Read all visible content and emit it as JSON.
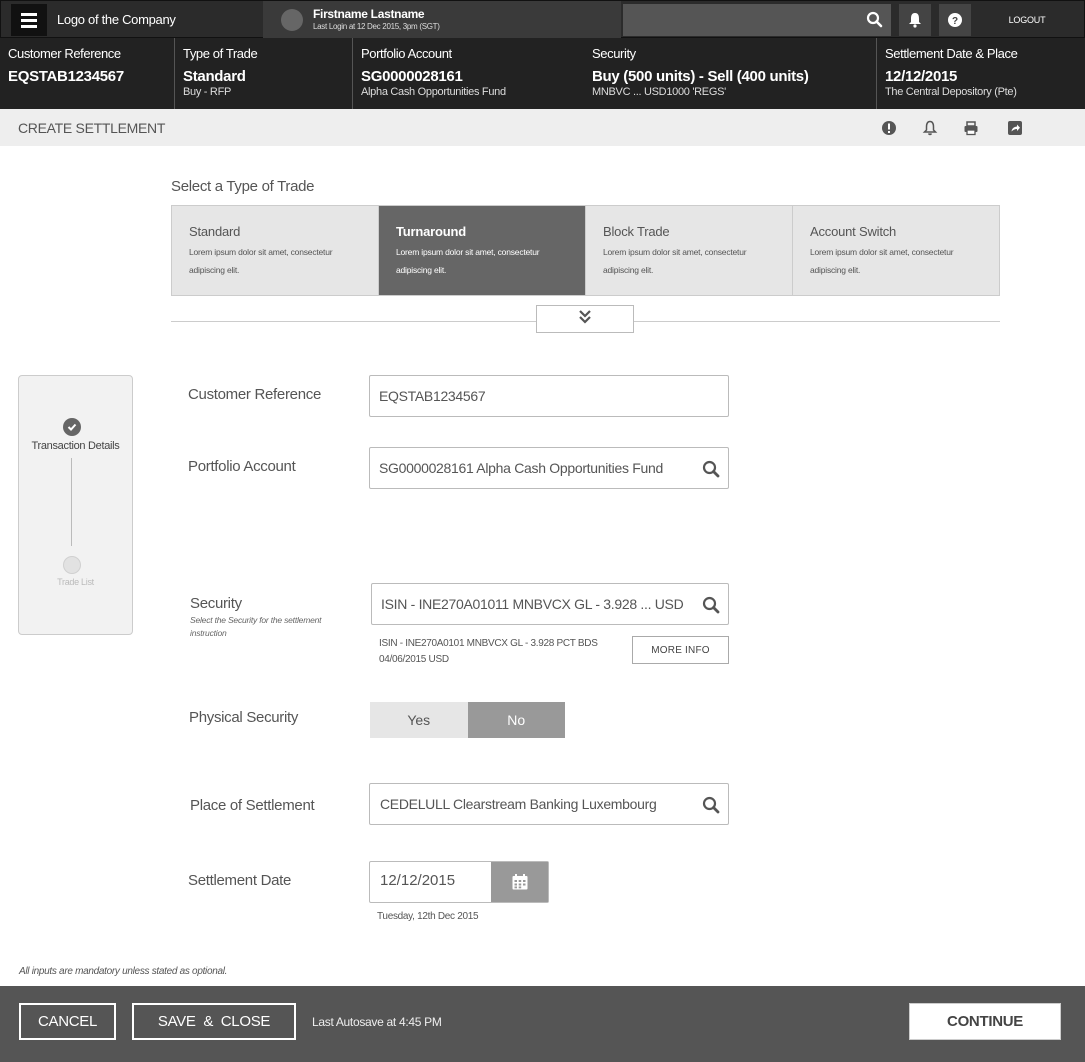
{
  "topbar": {
    "logo": "Logo of the Company",
    "user_name": "Firstname Lastname",
    "last_login": "Last Login at 12 Dec 2015, 3pm (SGT)",
    "logout_label": "LOGOUT"
  },
  "summary": [
    {
      "label": "Customer Reference",
      "value": "EQSTAB1234567",
      "sub": ""
    },
    {
      "label": "Type of Trade",
      "value": "Standard",
      "sub": "Buy - RFP"
    },
    {
      "label": "Portfolio Account",
      "value": "SG0000028161",
      "sub": "Alpha Cash Opportunities Fund"
    },
    {
      "label": "Security",
      "value": "Buy (500 units) - Sell (400 units)",
      "sub": "MNBVC ... USD1000 'REGS'"
    },
    {
      "label": "Settlement Date & Place",
      "value": "12/12/2015",
      "sub": "The Central Depository (Pte)"
    }
  ],
  "page": {
    "title": "CREATE SETTLEMENT"
  },
  "trade_type": {
    "title": "Select a Type of Trade",
    "selected": "Turnaround",
    "options": [
      {
        "name": "Standard",
        "desc": "Lorem ipsum dolor sit amet, consectetur adipiscing elit."
      },
      {
        "name": "Turnaround",
        "desc": "Lorem ipsum dolor sit amet, consectetur adipiscing elit."
      },
      {
        "name": "Block Trade",
        "desc": "Lorem ipsum dolor sit amet, consectetur adipiscing elit."
      },
      {
        "name": "Account Switch",
        "desc": "Lorem ipsum dolor sit amet, consectetur adipiscing elit."
      }
    ]
  },
  "stepper": {
    "steps": [
      {
        "label": "Transaction Details",
        "state": "completed"
      },
      {
        "label": "Trade List",
        "state": "pending"
      }
    ]
  },
  "form": {
    "customer_reference": {
      "label": "Customer Reference",
      "value": "EQSTAB1234567"
    },
    "portfolio_account": {
      "label": "Portfolio Account",
      "value": "SG0000028161  Alpha Cash Opportunities Fund"
    },
    "security": {
      "label": "Security",
      "hint": "Select the Security for the settlement instruction",
      "value": "ISIN - INE270A01011 MNBVCX GL - 3.928 ...  USD",
      "detail": "ISIN - INE270A0101 MNBVCX GL - 3.928 PCT BDS 04/06/2015 USD",
      "more_info_label": "MORE INFO"
    },
    "physical_security": {
      "label": "Physical Security",
      "yes": "Yes",
      "no": "No",
      "selected": "No"
    },
    "place_of_settlement": {
      "label": "Place of Settlement",
      "value": "CEDELULL Clearstream Banking Luxembourg"
    },
    "settlement_date": {
      "label": "Settlement Date",
      "value": "12/12/2015",
      "hint": "Tuesday, 12th Dec 2015"
    },
    "mandatory_note": "All inputs are mandatory unless stated as optional."
  },
  "footer": {
    "cancel_label": "CANCEL",
    "save_close_label": "SAVE  &  CLOSE",
    "autosave": "Last Autosave at 4:45 PM",
    "continue_label": "CONTINUE"
  }
}
